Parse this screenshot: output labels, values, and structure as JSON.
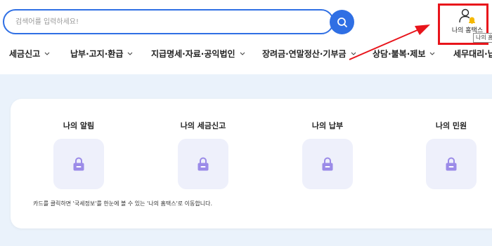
{
  "search": {
    "placeholder": "검색어를 입력하세요!"
  },
  "header": {
    "my_hometax_label": "나의 홈택스",
    "tooltip_text": "나의 홈"
  },
  "nav": {
    "items": [
      {
        "label": "세금신고"
      },
      {
        "label": "납부·고지·환급"
      },
      {
        "label": "지급명세·자료·공익법인"
      },
      {
        "label": "장려금·연말정산·기부금"
      },
      {
        "label": "상담·불복·제보"
      },
      {
        "label": "세무대리·납"
      }
    ]
  },
  "card": {
    "tiles": [
      {
        "title": "나의 알림"
      },
      {
        "title": "나의 세금신고"
      },
      {
        "title": "나의 납부"
      },
      {
        "title": "나의 민원"
      }
    ],
    "note": "카드를 클릭하면 '국세정보'를 한눈에 볼 수 있는 '나의 홈택스'로 이동합니다."
  },
  "colors": {
    "primary": "#2f6fe4",
    "annotation_red": "#e8141b",
    "band_bg": "#eaf2fb",
    "tile_bg": "#eef0fb",
    "lock_purple": "#9b8be8",
    "bell_yellow": "#f5b800"
  }
}
